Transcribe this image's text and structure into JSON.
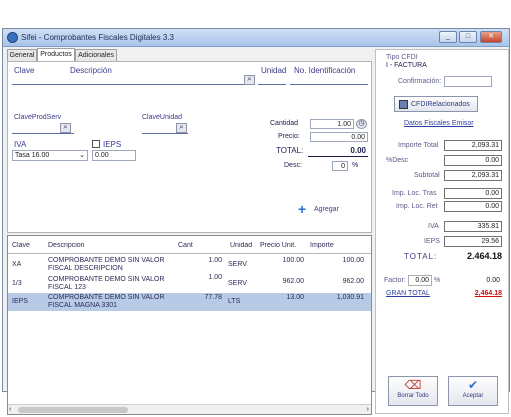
{
  "window": {
    "title": "Sifei - Comprobantes Fiscales Digitales 3.3",
    "controls": {
      "minimize": "_",
      "maximize": "□",
      "close": "✕"
    }
  },
  "tabs": [
    {
      "label": "General"
    },
    {
      "label": "Productos"
    },
    {
      "label": "Adicionales"
    }
  ],
  "form": {
    "clave_label": "Clave",
    "descripcion_label": "Descripción",
    "unidad_label": "Unidad",
    "no_ident_label": "No. Identificación",
    "clave_prod_serv_label": "ClaveProdServ",
    "clave_unidad_label": "ClaveUnidad",
    "cantidad_label": "Cantidad",
    "cantidad_value": "1.00",
    "precio_label": "Precio:",
    "precio_value": "0.00",
    "total_label": "TOTAL:",
    "total_value": "0.00",
    "desc_label": "Desc:",
    "desc_value": "0",
    "desc_unit": "%",
    "iva_label": "IVA",
    "iva_selected": "Tasa 16.00",
    "ieps_label": "IEPS",
    "ieps_value": "0.00",
    "agregar_label": "Agregar"
  },
  "grid": {
    "headers": [
      "Clave",
      "Descripcion",
      "Cant",
      "Unidad",
      "Precio Unit.",
      "Importe"
    ],
    "rows": [
      {
        "clave": "XA",
        "descripcion_1": "COMPROBANTE DEMO SIN VALOR",
        "descripcion_2": "FISCAL DESCRIPCION",
        "cant": "1.00",
        "unidad": "SERV",
        "precio": "100.00",
        "importe": "100.00"
      },
      {
        "clave": "1/3",
        "descripcion_1": "COMPROBANTE DEMO SIN VALOR",
        "descripcion_2": "FISCAL 123",
        "cant": "1.00",
        "unidad": "SERV",
        "precio": "962.00",
        "importe": "962.00"
      },
      {
        "clave": "IEPS",
        "descripcion_1": "COMPROBANTE DEMO SIN VALOR",
        "descripcion_2": "FISCAL MAGNA 3301",
        "cant": "77.78",
        "unidad": "LTS",
        "precio": "13.00",
        "importe": "1,030.91"
      }
    ]
  },
  "summary": {
    "tipo_cfdi_label": "Tipo CFDI",
    "tipo_cfdi_value": "I - FACTURA",
    "confirmacion_label": "Confirmación:",
    "cfdi_relacionados_label": "CFDIRelacionados",
    "datos_fiscales_label": "Datos Fiscales Emisor",
    "importe_total_label": "Importe Total",
    "importe_total_value": "2,093.31",
    "desc_label": "%Desc",
    "desc_value": "0.00",
    "subtotal_label": "Subtotal",
    "subtotal_value": "2,093.31",
    "imp_loc_tras_label": "Imp. Loc. Tras",
    "imp_loc_tras_value": "0.00",
    "imp_loc_ret_label": "Imp. Loc. Ret",
    "imp_loc_ret_value": "0.00",
    "iva_label": "IVA",
    "iva_value": "335.81",
    "ieps_label": "IEPS",
    "ieps_value": "29.56",
    "total_label": "TOTAL:",
    "total_value": "2.464.18",
    "factor_label": "Factor:",
    "factor_value": "0.00",
    "factor_unit": "%",
    "factor_amount": "0.00",
    "gran_total_label": "GRAN TOTAL",
    "gran_total_value": "2,464.18",
    "borrar_label": "Borrar Todo",
    "aceptar_label": "Aceptar"
  },
  "colors": {
    "link": "#2c3ea0",
    "gran_total": "#cc1111",
    "selected_row": "#b8cbe6",
    "titlebar": "#b8cfee"
  }
}
